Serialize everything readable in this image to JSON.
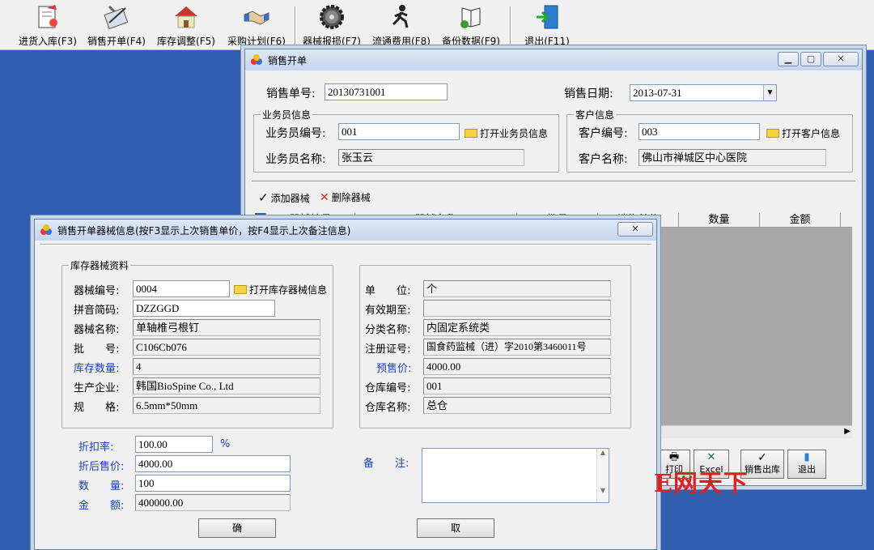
{
  "toolbar": {
    "items": [
      {
        "label": "进货入库(F3)"
      },
      {
        "label": "销售开单(F4)"
      },
      {
        "label": "库存调整(F5)"
      },
      {
        "label": "采购计划(F6)"
      },
      {
        "label": "器械报损(F7)"
      },
      {
        "label": "流通费用(F8)"
      },
      {
        "label": "备份数据(F9)"
      },
      {
        "label": "退出(F11)"
      }
    ]
  },
  "sales_window": {
    "title": "销售开单",
    "order_no_label": "销售单号:",
    "order_no": "20130731001",
    "date_label": "销售日期:",
    "date": "2013-07-31",
    "salesman_group": "业务员信息",
    "salesman_id_label": "业务员编号:",
    "salesman_id": "001",
    "open_salesman": "打开业务员信息",
    "salesman_name_label": "业务员名称:",
    "salesman_name": "张玉云",
    "customer_group": "客户信息",
    "customer_id_label": "客户编号:",
    "customer_id": "003",
    "open_customer": "打开客户信息",
    "customer_name_label": "客户名称:",
    "customer_name": "佛山市禅城区中心医院",
    "add_item": "添加器械",
    "delete_item": "删除器械",
    "columns": [
      "器械编号",
      "器械名称",
      "批号",
      "销售单价",
      "数量",
      "金额"
    ],
    "print_label": "打印",
    "excel_label": "Excel",
    "checkout_label": "销售出库",
    "exit_label": "退出"
  },
  "item_dialog": {
    "title": "销售开单器械信息(按F3显示上次销售单价，按F4显示上次备注信息)",
    "stock_group": "库存器械资料",
    "code_label": "器械编号:",
    "code": "0004",
    "open_stock": "打开库存器械信息",
    "pinyin_label": "拼音简码:",
    "pinyin": "DZZGGD",
    "name_label": "器械名称:",
    "name": "单轴椎弓根钉",
    "batch_label": "批　　号:",
    "batch": "C106Cb076",
    "stock_qty_label": "库存数量:",
    "stock_qty": "4",
    "maker_label": "生产企业:",
    "maker": "韩国BioSpine Co., Ltd",
    "spec_label": "规　　格:",
    "spec": "6.5mm*50mm",
    "unit_label": "单　　位:",
    "unit": "个",
    "expire_label": "有效期至:",
    "expire": "",
    "category_label": "分类名称:",
    "category": "内固定系统类",
    "reg_label": "注册证号:",
    "reg": "国食药监械（进）字2010第3460011号",
    "preset_price_label": "预售价:",
    "preset_price": "4000.00",
    "warehouse_no_label": "仓库编号:",
    "warehouse_no": "001",
    "warehouse_name_label": "仓库名称:",
    "warehouse_name": "总仓",
    "discount_label": "折扣率:",
    "discount": "100.00",
    "percent": "%",
    "discount_price_label": "折后售价:",
    "discount_price": "4000.00",
    "qty_label": "数　　量:",
    "qty": "100",
    "amount_label": "金　　额:",
    "amount": "400000.00",
    "remark_label": "备　　注:",
    "remark": "",
    "ok": "确",
    "cancel": "取"
  },
  "watermark": "E网天下",
  "colors": {
    "desktop": "#2f5fae",
    "window": "#f0f0f0",
    "label_blue": "#1b3fb8",
    "watermark": "#e02020"
  }
}
